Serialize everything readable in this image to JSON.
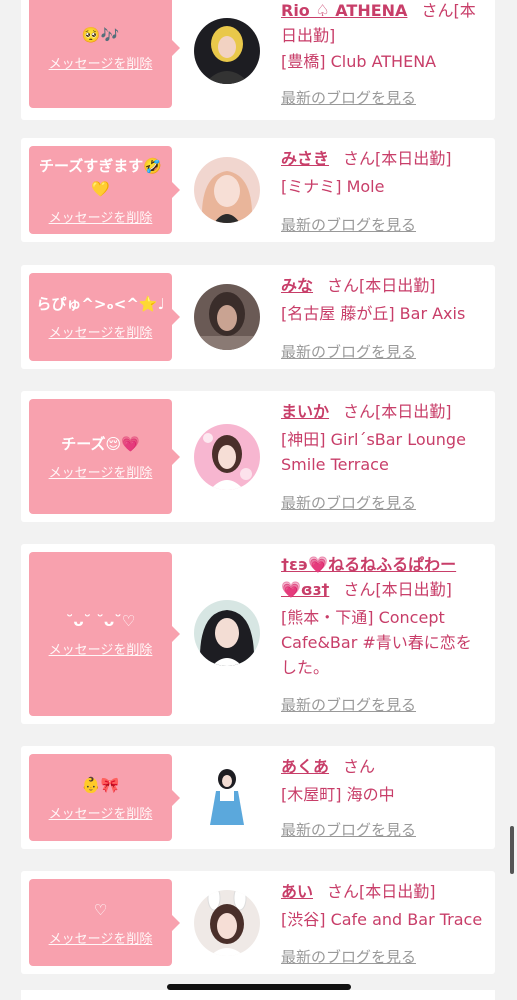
{
  "colors": {
    "bubble": "#f8a1ae",
    "accent": "#c83e69",
    "muted": "#999999",
    "background": "#f2f2f2"
  },
  "delete_label": "メッセージを削除",
  "blog_label": "最新のブログを見る",
  "san": "さん",
  "items": [
    {
      "message": "🥺🎶",
      "name": "Rio ♤ ATHENA",
      "status": "[本日出勤]",
      "shop": "[豊橋] Club ATHENA",
      "avatar_icon": "avatar-girl-blonde"
    },
    {
      "message": "チーズすぎます🤣💛",
      "name": "みさき",
      "status": "[本日出勤]",
      "shop": "[ミナミ] Mole",
      "avatar_icon": "avatar-girl-pink"
    },
    {
      "message": "らぴゅ^>ₒ<^⭐️♩",
      "name": "みな",
      "status": "[本日出勤]",
      "shop": "[名古屋 藤が丘] Bar Axis",
      "avatar_icon": "avatar-girl-blurred"
    },
    {
      "message": "チーズ😌💗",
      "name": "まいか",
      "status": "[本日出勤]",
      "shop": "[神田] Girl´sBar Lounge Smile Terrace",
      "avatar_icon": "avatar-girl-pink-bg"
    },
    {
      "message": "˘ᴗ˘ ˘ᴗ˘♡",
      "name_line1": "†ε϶💗ねるねふるぱわー",
      "name_line2": "💗ɞɜ†",
      "status": "[本日出勤]",
      "shop": "[熊本・下通] Concept Cafe&Bar #青い春に恋をした。",
      "avatar_icon": "avatar-girl-dark-hair"
    },
    {
      "message": "👶🎀",
      "name": "あくあ",
      "status": "",
      "shop": "[木屋町] 海の中",
      "avatar_icon": "avatar-girl-blue-dress"
    },
    {
      "message": "♡",
      "name": "あい",
      "status": "[本日出勤]",
      "shop": "[渋谷] Cafe and Bar Trace",
      "avatar_icon": "avatar-girl-bunny"
    }
  ]
}
